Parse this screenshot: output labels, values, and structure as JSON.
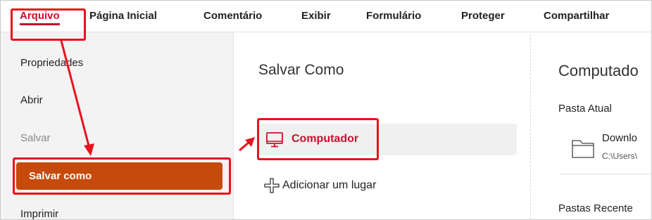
{
  "menubar": {
    "items": [
      {
        "label": "Arquivo",
        "active": true
      },
      {
        "label": "Página Inicial"
      },
      {
        "label": "Comentário"
      },
      {
        "label": "Exibir"
      },
      {
        "label": "Formulário"
      },
      {
        "label": "Proteger"
      },
      {
        "label": "Compartilhar"
      }
    ]
  },
  "sidebar": {
    "items": [
      {
        "label": "Propriedades"
      },
      {
        "label": "Abrir"
      },
      {
        "label": "Salvar",
        "disabled": true
      },
      {
        "label": "Salvar como",
        "selected": true
      },
      {
        "label": "Imprimir"
      }
    ]
  },
  "middle": {
    "title": "Salvar Como",
    "options": [
      {
        "label": "Computador",
        "icon": "monitor-icon",
        "selected": true
      },
      {
        "label": "Adicionar um lugar",
        "icon": "plus-icon"
      }
    ]
  },
  "right": {
    "title": "Computado",
    "current_folder_heading": "Pasta Atual",
    "current_folder": {
      "name": "Downlo",
      "path": "C:\\Users\\",
      "icon": "folder-icon"
    },
    "recent_heading": "Pastas Recente"
  },
  "colors": {
    "accent": "#c8102e",
    "selected_bg": "#c64a0c",
    "annotation": "#e8121d"
  }
}
